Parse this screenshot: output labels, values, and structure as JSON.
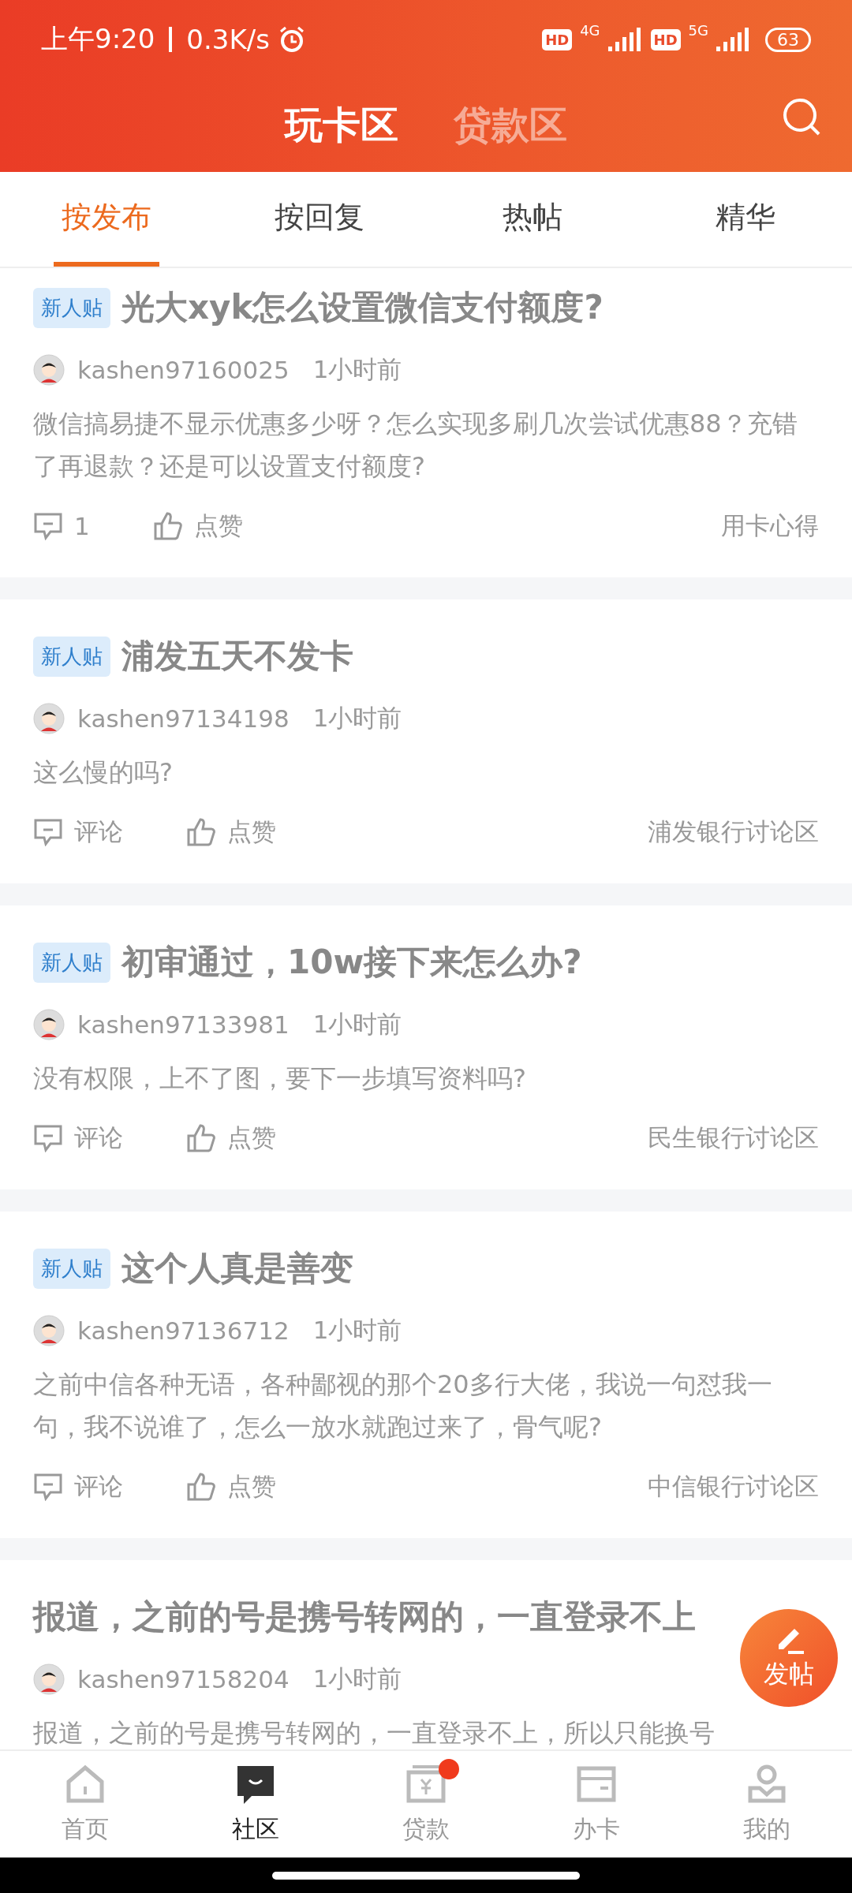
{
  "status_bar": {
    "time": "上午9:20",
    "speed": "0.3K/s",
    "sim1": {
      "hd": "HD",
      "network": "4G"
    },
    "sim2": {
      "hd": "HD",
      "network": "5G"
    },
    "battery": "63"
  },
  "header": {
    "tabs": [
      {
        "label": "玩卡区",
        "selected": true
      },
      {
        "label": "贷款区",
        "selected": false
      }
    ]
  },
  "sort_tabs": [
    {
      "label": "按发布",
      "selected": true
    },
    {
      "label": "按回复",
      "selected": false
    },
    {
      "label": "热帖",
      "selected": false
    },
    {
      "label": "精华",
      "selected": false
    }
  ],
  "posts": [
    {
      "tag": "新人贴",
      "title": "光大xyk怎么设置微信支付额度?",
      "author": "kashen97160025",
      "time": "1小时前",
      "body": "微信搞易捷不显示优惠多少呀？怎么实现多刷几次尝试优惠88？充错了再退款？还是可以设置支付额度?",
      "comments": "1",
      "likes": "点赞",
      "category": "用卡心得"
    },
    {
      "tag": "新人贴",
      "title": "浦发五天不发卡",
      "author": "kashen97134198",
      "time": "1小时前",
      "body": "这么慢的吗?",
      "comments": "评论",
      "likes": "点赞",
      "category": "浦发银行讨论区"
    },
    {
      "tag": "新人贴",
      "title": "初审通过，10w接下来怎么办?",
      "author": "kashen97133981",
      "time": "1小时前",
      "body": "没有权限，上不了图，要下一步填写资料吗?",
      "comments": "评论",
      "likes": "点赞",
      "category": "民生银行讨论区"
    },
    {
      "tag": "新人贴",
      "title": "这个人真是善变",
      "author": "kashen97136712",
      "time": "1小时前",
      "body": "之前中信各种无语，各种鄙视的那个20多行大佬，我说一句怼我一句，我不说谁了，怎么一放水就跑过来了，骨气呢?",
      "comments": "评论",
      "likes": "点赞",
      "category": "中信银行讨论区"
    },
    {
      "title": "报道，之前的号是携号转网的，一直登录不上",
      "author": "kashen97158204",
      "time": "1小时前",
      "body": "报道，之前的号是携号转网的，一直登录不上，所以只能换号"
    }
  ],
  "fab": {
    "label": "发帖"
  },
  "bottom_nav": [
    {
      "label": "首页",
      "kind": "home",
      "selected": false,
      "dot": false
    },
    {
      "label": "社区",
      "kind": "chat",
      "selected": true,
      "dot": false
    },
    {
      "label": "贷款",
      "kind": "loan",
      "selected": false,
      "dot": true
    },
    {
      "label": "办卡",
      "kind": "card",
      "selected": false,
      "dot": false
    },
    {
      "label": "我的",
      "kind": "user",
      "selected": false,
      "dot": false
    }
  ]
}
